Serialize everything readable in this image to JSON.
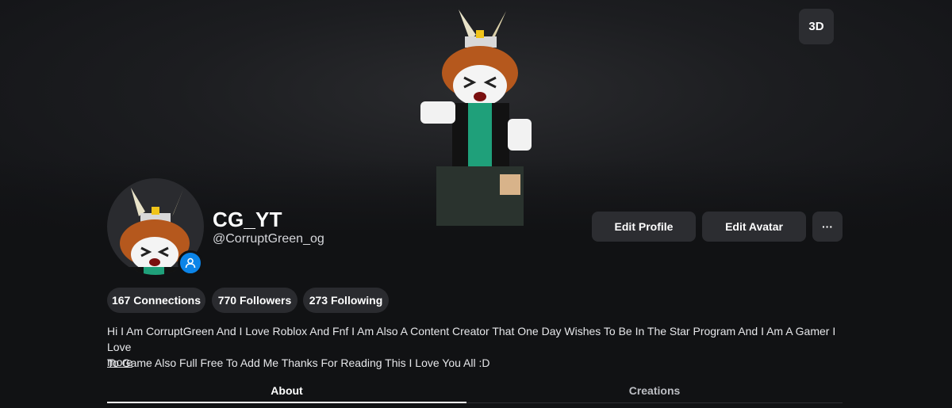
{
  "hero": {
    "view_toggle_label": "3D"
  },
  "profile": {
    "display_name": "CG_YT",
    "username": "@CorruptGreen_og"
  },
  "actions": {
    "edit_profile": "Edit Profile",
    "edit_avatar": "Edit Avatar",
    "more": "···"
  },
  "stats": {
    "connections": "167 Connections",
    "followers": "770 Followers",
    "following": "273 Following"
  },
  "bio": {
    "line1": "Hi I Am CorruptGreen And I Love Roblox And Fnf I Am Also A Content Creator That One Day Wishes To Be In The Star Program And I Am A Gamer I Love",
    "line2": "To Game Also Full Free To Add Me Thanks For Reading This I Love You All :D",
    "more_link": "more"
  },
  "tabs": [
    {
      "label": "About",
      "active": true
    },
    {
      "label": "Creations",
      "active": false
    }
  ],
  "colors": {
    "background": "#111214",
    "button": "#2c2d31",
    "presence": "#0b84e8",
    "accent_green": "#1fa07a"
  },
  "icons": {
    "presence": "user-icon",
    "more": "ellipsis-icon"
  }
}
